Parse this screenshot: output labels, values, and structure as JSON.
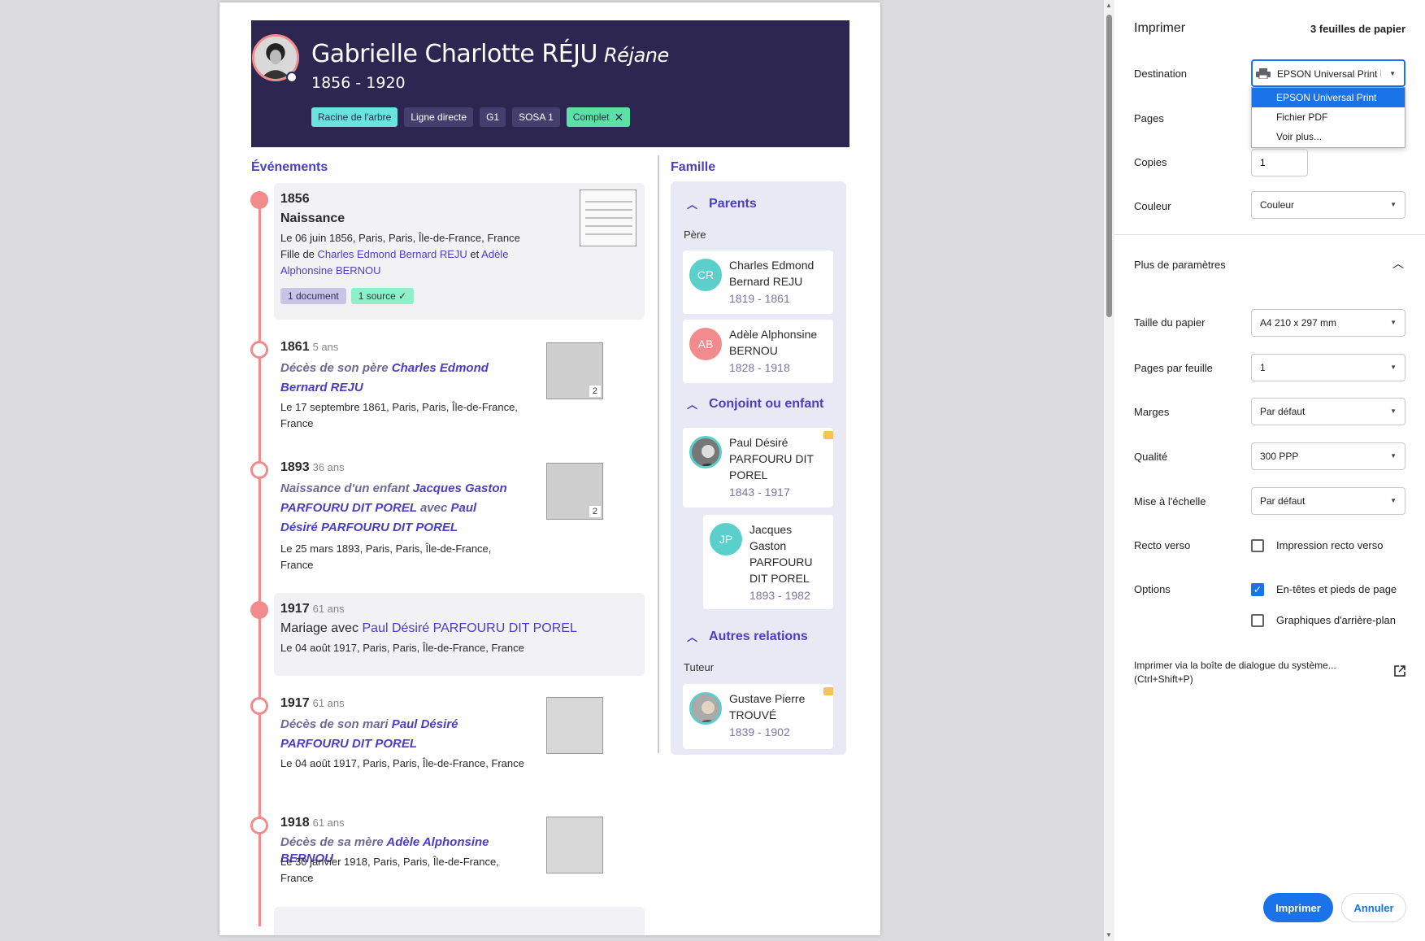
{
  "person": {
    "name": "Gabrielle Charlotte RÉJU",
    "nickname": "Réjane",
    "dates": "1856 - 1920",
    "tags": [
      "Racine de l'arbre",
      "Ligne directe",
      "G1",
      "SOSA 1",
      "Complet"
    ]
  },
  "events_title": "Événements",
  "family_title": "Famille",
  "events": [
    {
      "year": "1856",
      "title": "Naissance",
      "place": "Le 06 juin 1856, Paris, Paris, Île-de-France, France",
      "parents_prefix": "Fille de",
      "father": "Charles Edmond Bernard REJU",
      "and": "et",
      "mother": "Adèle Alphonsine BERNOU",
      "chip_documents": "1 document",
      "chip_sources": "1 source"
    },
    {
      "year": "1861",
      "age": "5 ans",
      "desc": "Décès de son père",
      "who": "Charles Edmond Bernard REJU",
      "place": "Le 17 septembre 1861, Paris, Paris, Île-de-France, France",
      "thumb_count": "2"
    },
    {
      "year": "1893",
      "age": "36 ans",
      "desc": "Naissance d'un enfant",
      "who": "Jacques Gaston PARFOURU DIT POREL",
      "with": "avec",
      "who2": "Paul Désiré PARFOURU DIT POREL",
      "place": "Le 25 mars 1893, Paris, Paris, Île-de-France, France",
      "thumb_count": "2"
    },
    {
      "year": "1917",
      "age": "61 ans",
      "title": "Mariage avec",
      "who": "Paul Désiré PARFOURU DIT POREL",
      "place": "Le 04 août 1917, Paris, Paris, Île-de-France, France"
    },
    {
      "year": "1917",
      "age": "61 ans",
      "desc": "Décès de son mari",
      "who": "Paul Désiré PARFOURU DIT POREL",
      "place": "Le 04 août 1917, Paris, Paris, Île-de-France, France"
    },
    {
      "year": "1918",
      "age": "61 ans",
      "desc": "Décès de sa mère",
      "who": "Adèle Alphonsine BERNOU",
      "place": "Le 30 janvier 1918, Paris, Paris, Île-de-France, France"
    }
  ],
  "family": {
    "parents_title": "Parents",
    "father_label": "Père",
    "father": {
      "initials": "CR",
      "name": "Charles Edmond Bernard REJU",
      "dates": "1819 - 1861"
    },
    "mother": {
      "initials": "AB",
      "name": "Adèle Alphonsine BERNOU",
      "dates": "1828 - 1918"
    },
    "spouse_title": "Conjoint ou enfant",
    "spouse": {
      "name": "Paul Désiré PARFOURU DIT POREL",
      "dates": "1843 - 1917"
    },
    "child": {
      "initials": "JP",
      "name": "Jacques Gaston PARFOURU DIT POREL",
      "dates": "1893 - 1982"
    },
    "other_title": "Autres relations",
    "tutor_label": "Tuteur",
    "tutor": {
      "name": "Gustave Pierre TROUVÉ",
      "dates": "1839 - 1902"
    }
  },
  "print": {
    "title": "Imprimer",
    "sheets": "3 feuilles de papier",
    "destination_label": "Destination",
    "destination_value": "EPSON Universal Print Driver",
    "destination_options": [
      "EPSON Universal Print Driver",
      "Fichier PDF",
      "Voir plus..."
    ],
    "pages_label": "Pages",
    "copies_label": "Copies",
    "copies_value": "1",
    "color_label": "Couleur",
    "color_value": "Couleur",
    "more_label": "Plus de paramètres",
    "paper_label": "Taille du papier",
    "paper_value": "A4 210 x 297 mm",
    "pps_label": "Pages par feuille",
    "pps_value": "1",
    "margins_label": "Marges",
    "margins_value": "Par défaut",
    "quality_label": "Qualité",
    "quality_value": "300 PPP",
    "scale_label": "Mise à l'échelle",
    "scale_value": "Par défaut",
    "duplex_label": "Recto verso",
    "duplex_option": "Impression recto verso",
    "options_label": "Options",
    "opt_headers": "En-têtes et pieds de page",
    "opt_background": "Graphiques d'arrière-plan",
    "system_dialog": "Imprimer via la boîte de dialogue du système... (Ctrl+Shift+P)",
    "print_button": "Imprimer",
    "cancel_button": "Annuler"
  },
  "colors": {
    "accent": "#1a73e8",
    "hero": "#2c2650",
    "link": "#4a3fc4",
    "timeline": "#f28b8b"
  }
}
